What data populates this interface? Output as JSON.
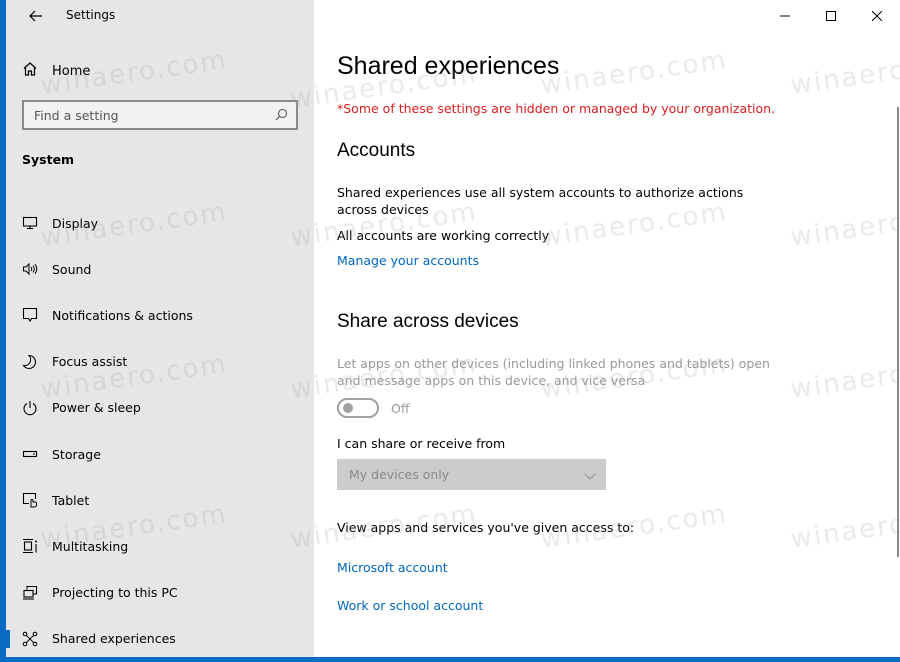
{
  "window": {
    "title": "Settings",
    "controls": {
      "minimize_icon": "minimize-icon",
      "maximize_icon": "maximize-icon",
      "close_icon": "close-icon"
    },
    "accent_color": "#0a6bc4"
  },
  "sidebar": {
    "back_icon": "arrow-left-icon",
    "home_label": "Home",
    "search": {
      "placeholder": "Find a setting",
      "value": ""
    },
    "section_label": "System",
    "items": [
      {
        "label": "Display",
        "icon": "monitor-icon"
      },
      {
        "label": "Sound",
        "icon": "speaker-icon"
      },
      {
        "label": "Notifications & actions",
        "icon": "notification-icon"
      },
      {
        "label": "Focus assist",
        "icon": "moon-icon"
      },
      {
        "label": "Power & sleep",
        "icon": "power-icon"
      },
      {
        "label": "Storage",
        "icon": "storage-icon"
      },
      {
        "label": "Tablet",
        "icon": "tablet-icon"
      },
      {
        "label": "Multitasking",
        "icon": "multitasking-icon"
      },
      {
        "label": "Projecting to this PC",
        "icon": "projecting-icon"
      },
      {
        "label": "Shared experiences",
        "icon": "shared-experiences-icon",
        "selected": true
      }
    ]
  },
  "main": {
    "title": "Shared experiences",
    "org_notice": "*Some of these settings are hidden or managed by your organization.",
    "org_notice_color": "#d81e1e",
    "accounts": {
      "heading": "Accounts",
      "description": "Shared experiences use all system accounts to authorize actions across devices",
      "status": "All accounts are working correctly",
      "manage_link": "Manage your accounts"
    },
    "share_across": {
      "heading": "Share across devices",
      "description": "Let apps on other devices (including linked phones and tablets) open and message apps on this device, and vice versa",
      "toggle": {
        "state": "off",
        "label": "Off",
        "enabled": false
      },
      "share_from_label": "I can share or receive from",
      "share_from_value": "My devices only",
      "access_label": "View apps and services you've given access to:",
      "links": [
        "Microsoft account",
        "Work or school account"
      ]
    },
    "link_color": "#0067c0"
  },
  "watermark": "winaero.com"
}
